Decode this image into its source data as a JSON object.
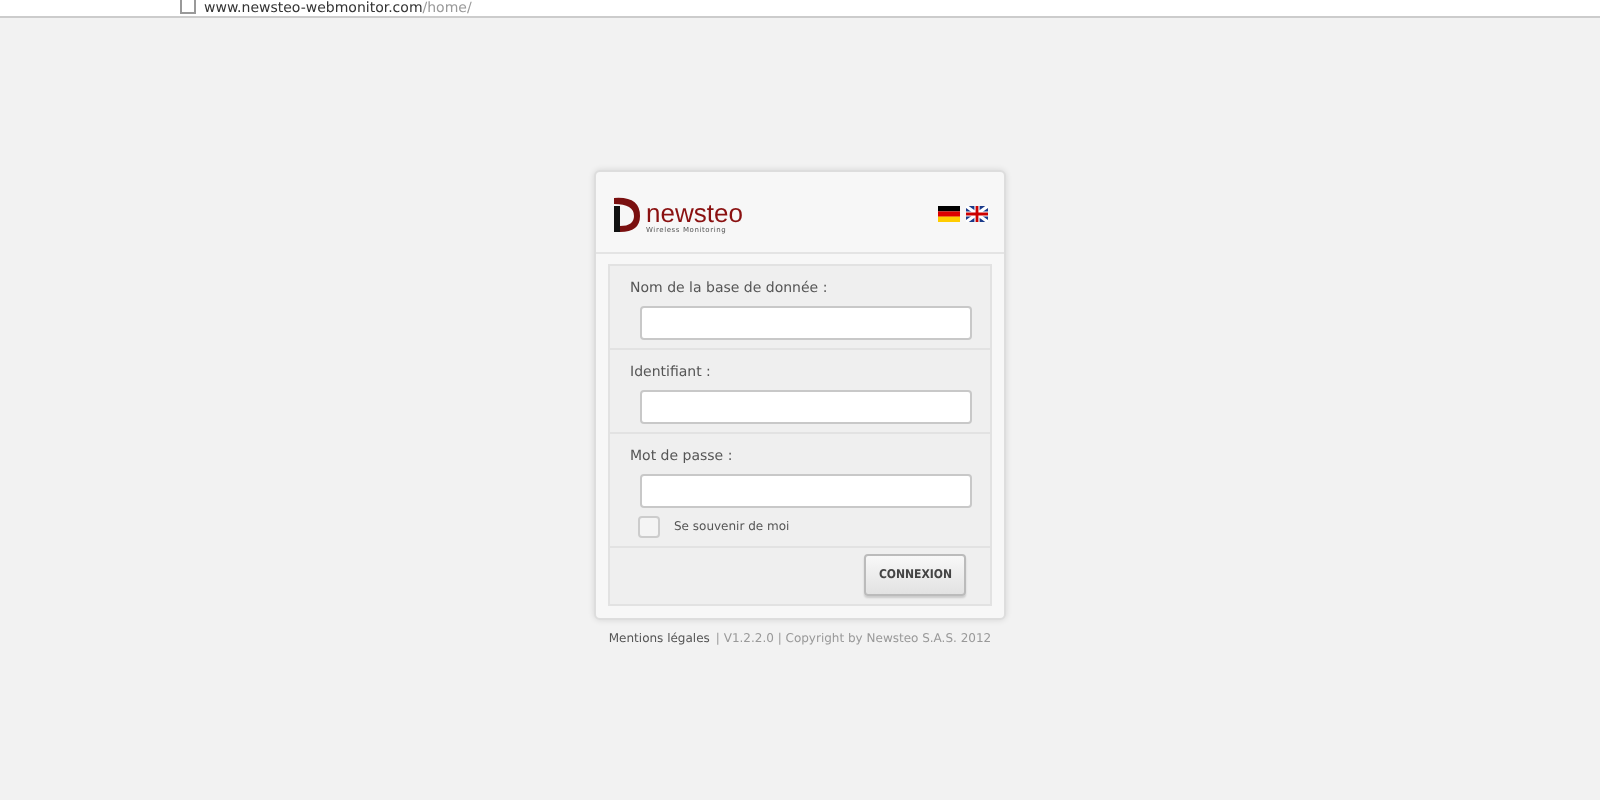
{
  "browser": {
    "url": "www.newsteo-webmonitor.com",
    "path": "/home/"
  },
  "logo": {
    "name": "newsteo",
    "tagline": "Wireless Monitoring"
  },
  "fields": [
    {
      "label": "Nom de la base de donnée :"
    },
    {
      "label": "Identifiant :"
    },
    {
      "label": "Mot de passe :"
    }
  ],
  "remember": {
    "label": "Se souvenir de moi",
    "checked": false
  },
  "submit": "CONNEXION",
  "footer": {
    "link": "Mentions légales",
    "text": "| V1.2.2.0 | Copyright by Newsteo S.A.S. 2012"
  }
}
